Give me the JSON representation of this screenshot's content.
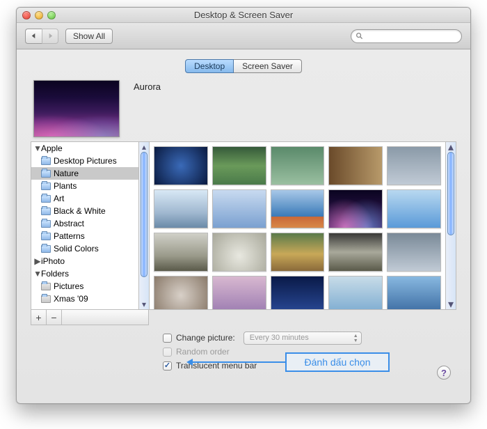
{
  "window": {
    "title": "Desktop & Screen Saver"
  },
  "toolbar": {
    "showall_label": "Show All",
    "search_placeholder": ""
  },
  "tabs": {
    "desktop": "Desktop",
    "screensaver": "Screen Saver"
  },
  "current_picture": "Aurora",
  "sidebar": {
    "groups": [
      {
        "label": "Apple",
        "expanded": true
      },
      {
        "label": "iPhoto",
        "expanded": false
      },
      {
        "label": "Folders",
        "expanded": true
      }
    ],
    "apple_items": [
      "Desktop Pictures",
      "Nature",
      "Plants",
      "Art",
      "Black & White",
      "Abstract",
      "Patterns",
      "Solid Colors"
    ],
    "folders_items": [
      "Pictures",
      "Xmas '09"
    ],
    "selected": "Nature"
  },
  "options": {
    "change_picture_label": "Change picture:",
    "change_picture_checked": false,
    "interval": "Every 30 minutes",
    "random_label": "Random order",
    "random_checked": false,
    "translucent_label": "Translucent menu bar",
    "translucent_checked": true
  },
  "callout": "Đánh dấu chọn"
}
